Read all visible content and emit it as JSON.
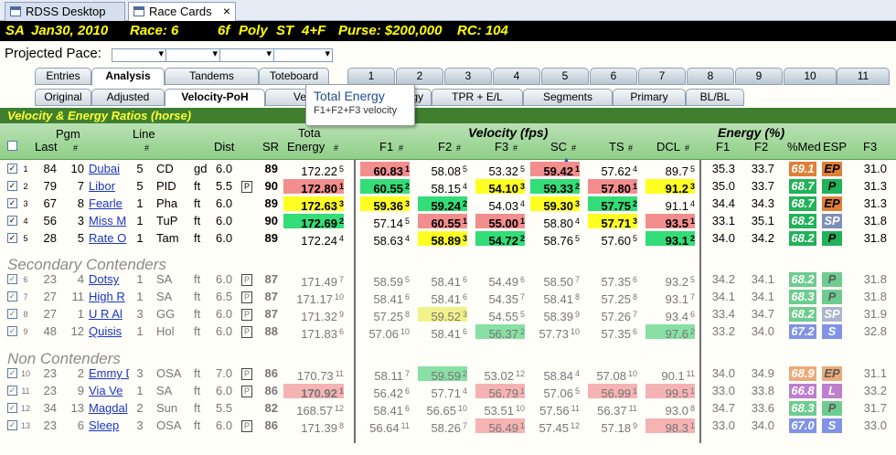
{
  "doc_tabs": [
    {
      "label": "RDSS Desktop"
    },
    {
      "label": "Race Cards",
      "close": "×"
    }
  ],
  "header": {
    "track": "SA",
    "date": "Jan30, 2010",
    "race": "Race: 6",
    "dist": "6f",
    "surface": "Poly",
    "type": "ST",
    "cond": "4+F",
    "purse": "Purse: $200,000",
    "rc": "RC: 104"
  },
  "projected_pace_label": "Projected Pace:",
  "tabs_row1": [
    "Entries",
    "Analysis",
    "Tandems",
    "Toteboard"
  ],
  "race_tabs": [
    "1",
    "2",
    "3",
    "4",
    "5",
    "6",
    "7",
    "8",
    "9",
    "10",
    "11"
  ],
  "tabs_row2": [
    "Original",
    "Adjusted",
    "Velocity-PoH",
    "Ve",
    "gy",
    "TPR + E/L",
    "Segments",
    "Primary",
    "BL/BL"
  ],
  "tooltip": {
    "title": "Total Energy",
    "sub": "F1+F2+F3 velocity"
  },
  "grid_title": "Velocity & Energy Ratios (horse)",
  "cols": {
    "last": "Last",
    "pgm": "Pgm",
    "pgm_hash": "#",
    "line": "Line",
    "line_hash": "#",
    "dist": "Dist",
    "sr": "SR",
    "total": "Tota",
    "energy": "Energy",
    "hash": "#",
    "vel": "Velocity (fps)",
    "en": "Energy (%)",
    "f1": "F1",
    "f2": "F2",
    "f3": "F3",
    "sc": "SC",
    "ts": "TS",
    "dcl": "DCL",
    "ef1": "F1",
    "ef2": "F2",
    "med": "%Med",
    "esp": "ESP",
    "ef3": "F3"
  },
  "sections": [
    "Secondary Contenders",
    "Non Contenders"
  ],
  "rows": [
    {
      "n": "1",
      "last": "84",
      "pgm": "10",
      "name": "Dubai",
      "line": "5",
      "trk": "CD",
      "cond": "gd",
      "dist": "6.0",
      "box": "",
      "sr": "89",
      "energy": "172.22",
      "er": "5",
      "f1": "60.83",
      "f1r": "1",
      "f2": "58.08",
      "f2r": "5",
      "f3": "53.32",
      "f3r": "5",
      "sc": "59.42",
      "scr": "1",
      "ts": "57.62",
      "tsr": "4",
      "dcl": "89.7",
      "dclr": "5",
      "e1": "35.3",
      "e2": "33.7",
      "med": "69.1",
      "esp": "EP",
      "e3": "31.0"
    },
    {
      "n": "2",
      "last": "79",
      "pgm": "7",
      "name": "Libor",
      "line": "5",
      "trk": "PID",
      "cond": "ft",
      "dist": "5.5",
      "box": "P",
      "sr": "90",
      "energy": "172.80",
      "er": "1",
      "f1": "60.55",
      "f1r": "2",
      "f2": "58.15",
      "f2r": "4",
      "f3": "54.10",
      "f3r": "3",
      "sc": "59.33",
      "scr": "2",
      "ts": "57.80",
      "tsr": "1",
      "dcl": "91.2",
      "dclr": "3",
      "e1": "35.0",
      "e2": "33.7",
      "med": "68.7",
      "esp": "P",
      "e3": "31.3"
    },
    {
      "n": "3",
      "last": "67",
      "pgm": "8",
      "name": "Fearle",
      "line": "1",
      "trk": "Pha",
      "cond": "ft",
      "dist": "6.0",
      "box": "",
      "sr": "89",
      "energy": "172.63",
      "er": "3",
      "f1": "59.36",
      "f1r": "3",
      "f2": "59.24",
      "f2r": "2",
      "f3": "54.03",
      "f3r": "4",
      "sc": "59.30",
      "scr": "3",
      "ts": "57.75",
      "tsr": "2",
      "dcl": "91.1",
      "dclr": "4",
      "e1": "34.4",
      "e2": "34.3",
      "med": "68.7",
      "esp": "EP",
      "e3": "31.3"
    },
    {
      "n": "4",
      "last": "56",
      "pgm": "3",
      "name": "Miss M",
      "line": "1",
      "trk": "TuP",
      "cond": "ft",
      "dist": "6.0",
      "box": "",
      "sr": "90",
      "energy": "172.69",
      "er": "2",
      "f1": "57.14",
      "f1r": "5",
      "f2": "60.55",
      "f2r": "1",
      "f3": "55.00",
      "f3r": "1",
      "sc": "58.80",
      "scr": "4",
      "ts": "57.71",
      "tsr": "3",
      "dcl": "93.5",
      "dclr": "1",
      "e1": "33.1",
      "e2": "35.1",
      "med": "68.2",
      "esp": "SP",
      "e3": "31.8"
    },
    {
      "n": "5",
      "last": "28",
      "pgm": "5",
      "name": "Rate O",
      "line": "1",
      "trk": "Tam",
      "cond": "ft",
      "dist": "6.0",
      "box": "",
      "sr": "89",
      "energy": "172.24",
      "er": "4",
      "f1": "58.63",
      "f1r": "4",
      "f2": "58.89",
      "f2r": "3",
      "f3": "54.72",
      "f3r": "2",
      "sc": "58.76",
      "scr": "5",
      "ts": "57.60",
      "tsr": "5",
      "dcl": "93.1",
      "dclr": "2",
      "e1": "34.0",
      "e2": "34.2",
      "med": "68.2",
      "esp": "P",
      "e3": "31.8"
    },
    {
      "n": "6",
      "last": "23",
      "pgm": "4",
      "name": "Dotsy",
      "line": "1",
      "trk": "SA",
      "cond": "ft",
      "dist": "6.0",
      "box": "P",
      "sr": "87",
      "energy": "171.49",
      "er": "7",
      "f1": "58.59",
      "f1r": "5",
      "f2": "58.41",
      "f2r": "6",
      "f3": "54.49",
      "f3r": "6",
      "sc": "58.50",
      "scr": "7",
      "ts": "57.35",
      "tsr": "6",
      "dcl": "93.2",
      "dclr": "5",
      "e1": "34.2",
      "e2": "34.1",
      "med": "68.2",
      "esp": "P",
      "e3": "31.8"
    },
    {
      "n": "7",
      "last": "27",
      "pgm": "11",
      "name": "High R",
      "line": "1",
      "trk": "SA",
      "cond": "ft",
      "dist": "6.5",
      "box": "P",
      "sr": "87",
      "energy": "171.17",
      "er": "10",
      "f1": "58.41",
      "f1r": "6",
      "f2": "58.41",
      "f2r": "6",
      "f3": "54.35",
      "f3r": "7",
      "sc": "58.41",
      "scr": "8",
      "ts": "57.25",
      "tsr": "8",
      "dcl": "93.1",
      "dclr": "7",
      "e1": "34.1",
      "e2": "34.1",
      "med": "68.3",
      "esp": "P",
      "e3": "31.8"
    },
    {
      "n": "8",
      "last": "27",
      "pgm": "1",
      "name": "U R Al",
      "line": "3",
      "trk": "GG",
      "cond": "ft",
      "dist": "6.0",
      "box": "P",
      "sr": "87",
      "energy": "171.32",
      "er": "9",
      "f1": "57.25",
      "f1r": "8",
      "f2": "59.52",
      "f2r": "3",
      "f3": "54.55",
      "f3r": "5",
      "sc": "58.39",
      "scr": "9",
      "ts": "57.26",
      "tsr": "7",
      "dcl": "93.4",
      "dclr": "6",
      "e1": "33.4",
      "e2": "34.7",
      "med": "68.2",
      "esp": "SP",
      "e3": "31.9"
    },
    {
      "n": "9",
      "last": "48",
      "pgm": "12",
      "name": "Quisis",
      "line": "1",
      "trk": "Hol",
      "cond": "ft",
      "dist": "6.0",
      "box": "P",
      "sr": "88",
      "energy": "171.83",
      "er": "6",
      "f1": "57.06",
      "f1r": "10",
      "f2": "58.41",
      "f2r": "6",
      "f3": "56.37",
      "f3r": "2",
      "sc": "57.73",
      "scr": "10",
      "ts": "57.35",
      "tsr": "6",
      "dcl": "97.6",
      "dclr": "2",
      "e1": "33.2",
      "e2": "34.0",
      "med": "67.2",
      "esp": "S",
      "e3": "32.8"
    },
    {
      "n": "10",
      "last": "23",
      "pgm": "2",
      "name": "Emmy D",
      "line": "3",
      "trk": "OSA",
      "cond": "ft",
      "dist": "7.0",
      "box": "P",
      "sr": "86",
      "energy": "170.73",
      "er": "11",
      "f1": "58.11",
      "f1r": "7",
      "f2": "59.59",
      "f2r": "2",
      "f3": "53.02",
      "f3r": "12",
      "sc": "58.84",
      "scr": "4",
      "ts": "57.08",
      "tsr": "10",
      "dcl": "90.1",
      "dclr": "11",
      "e1": "34.0",
      "e2": "34.9",
      "med": "68.9",
      "esp": "EP",
      "e3": "31.1"
    },
    {
      "n": "11",
      "last": "23",
      "pgm": "9",
      "name": "Via Ve",
      "line": "1",
      "trk": "SA",
      "cond": "ft",
      "dist": "6.0",
      "box": "P",
      "sr": "86",
      "energy": "170.92",
      "er": "1",
      "f1": "56.42",
      "f1r": "6",
      "f2": "57.71",
      "f2r": "4",
      "f3": "56.79",
      "f3r": "1",
      "sc": "57.06",
      "scr": "5",
      "ts": "56.99",
      "tsr": "1",
      "dcl": "99.5",
      "dclr": "1",
      "e1": "33.0",
      "e2": "33.8",
      "med": "66.8",
      "esp": "L",
      "e3": "33.2"
    },
    {
      "n": "12",
      "last": "34",
      "pgm": "13",
      "name": "Magdal",
      "line": "2",
      "trk": "Sun",
      "cond": "ft",
      "dist": "5.5",
      "box": "",
      "sr": "82",
      "energy": "168.57",
      "er": "12",
      "f1": "58.41",
      "f1r": "6",
      "f2": "56.65",
      "f2r": "10",
      "f3": "53.51",
      "f3r": "10",
      "sc": "57.56",
      "scr": "11",
      "ts": "56.37",
      "tsr": "11",
      "dcl": "93.0",
      "dclr": "8",
      "e1": "34.7",
      "e2": "33.6",
      "med": "68.3",
      "esp": "P",
      "e3": "31.7"
    },
    {
      "n": "13",
      "last": "23",
      "pgm": "6",
      "name": "Sleep",
      "line": "3",
      "trk": "OSA",
      "cond": "ft",
      "dist": "6.0",
      "box": "P",
      "sr": "86",
      "energy": "171.39",
      "er": "8",
      "f1": "56.64",
      "f1r": "11",
      "f2": "58.26",
      "f2r": "7",
      "f3": "56.49",
      "f3r": "1",
      "sc": "57.45",
      "scr": "12",
      "ts": "57.18",
      "tsr": "9",
      "dcl": "98.3",
      "dclr": "1",
      "e1": "33.0",
      "e2": "34.0",
      "med": "67.0",
      "esp": "S",
      "e3": "33.0"
    }
  ],
  "colors": {
    "red": "#f28e8e",
    "green": "#33dd77",
    "yellow": "#ffff22",
    "header_bg": "#000000",
    "header_fg": "#ffff00",
    "grid_title_bg": "#3f7f2f"
  }
}
